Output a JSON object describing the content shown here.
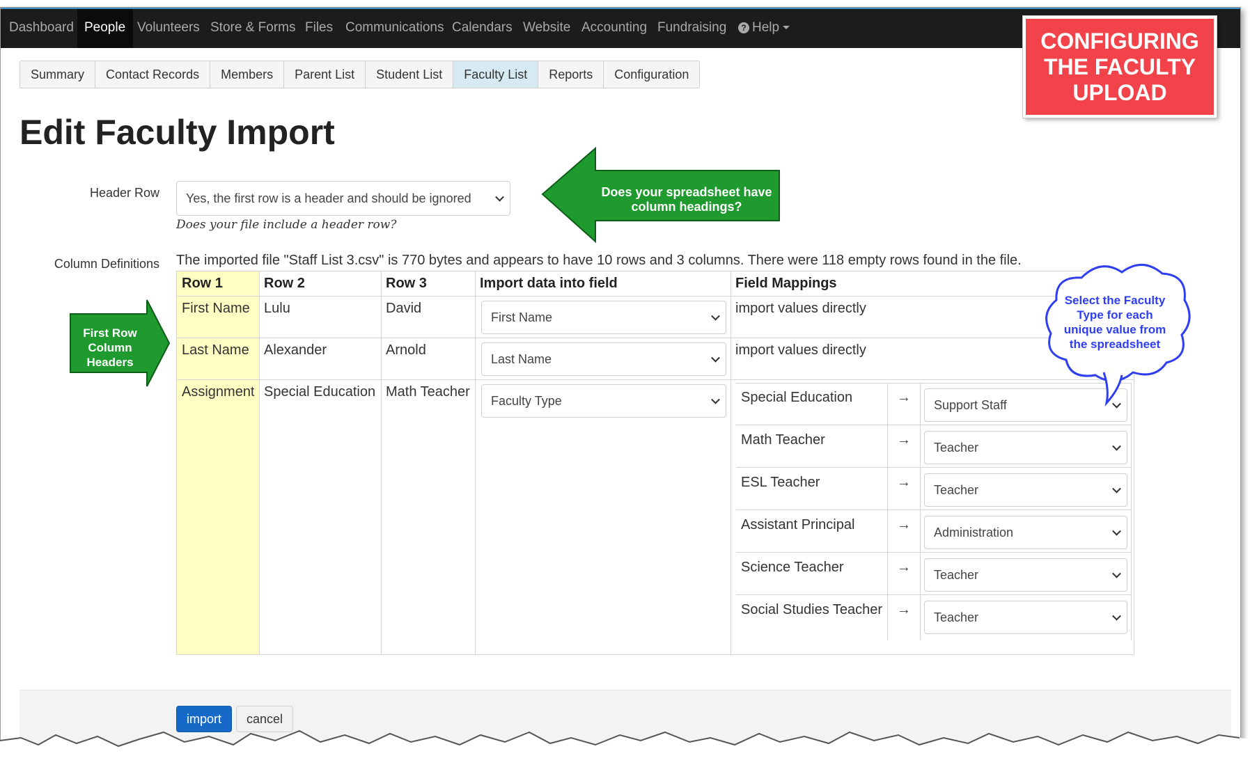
{
  "nav": {
    "items": [
      "Dashboard",
      "People",
      "Volunteers",
      "Store & Forms",
      "Files",
      "Communications",
      "Calendars",
      "Website",
      "Accounting",
      "Fundraising"
    ],
    "active": "People",
    "help_label": "Help"
  },
  "subtabs": [
    "Summary",
    "Contact Records",
    "Members",
    "Parent List",
    "Student List",
    "Faculty List",
    "Reports",
    "Configuration"
  ],
  "active_subtab": "Faculty List",
  "page_title": "Edit Faculty Import",
  "header_row": {
    "label": "Header Row",
    "value": "Yes, the first row is a header and should be ignored",
    "help": "Does your file include a header row?"
  },
  "column_definitions": {
    "label": "Column Definitions",
    "file_info": "The imported file \"Staff List 3.csv\" is 770 bytes and appears to have 10 rows and 3 columns. There were 118 empty rows found in the file.",
    "headers": [
      "Row 1",
      "Row 2",
      "Row 3",
      "Import data into field",
      "Field Mappings"
    ],
    "rows": [
      {
        "row1": "First Name",
        "row2": "Lulu",
        "row3": "David",
        "field": "First Name",
        "mapping": "import values directly"
      },
      {
        "row1": "Last Name",
        "row2": "Alexander",
        "row3": "Arnold",
        "field": "Last Name",
        "mapping": "import values directly"
      },
      {
        "row1": "Assignment",
        "row2": "Special Education",
        "row3": "Math Teacher",
        "field": "Faculty Type",
        "mapping": ""
      }
    ],
    "arrow_glyph": "→",
    "mappings": [
      {
        "source": "Special Education",
        "target": "Support Staff"
      },
      {
        "source": "Math Teacher",
        "target": "Teacher"
      },
      {
        "source": "ESL Teacher",
        "target": "Teacher"
      },
      {
        "source": "Assistant Principal",
        "target": "Administration"
      },
      {
        "source": "Science Teacher",
        "target": "Teacher"
      },
      {
        "source": "Social Studies Teacher",
        "target": "Teacher"
      }
    ]
  },
  "buttons": {
    "import": "import",
    "cancel": "cancel"
  },
  "annotations": {
    "badge_lines": [
      "CONFIGURING",
      "THE FACULTY",
      "UPLOAD"
    ],
    "header_callout_lines": [
      "Does your spreadsheet have",
      "column headings?"
    ],
    "first_row_callout_lines": [
      "First Row",
      "Column",
      "Headers"
    ],
    "cloud_lines": [
      "Select the Faculty",
      "Type for each",
      "unique value from",
      "the spreadsheet"
    ]
  },
  "colors": {
    "nav_bg": "#1c1c1c",
    "active_subtab_bg": "#d5eaf2",
    "row1_highlight": "#ffffc4",
    "import_button": "#1669c7",
    "badge_red": "#f2434a",
    "callout_green": "#1e9a2e",
    "cloud_blue": "#2e3ef0"
  }
}
